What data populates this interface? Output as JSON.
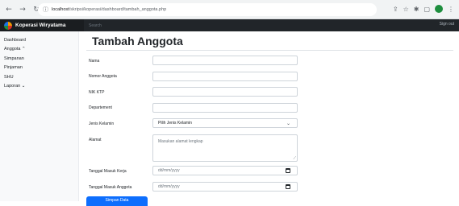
{
  "browser": {
    "url_host": "localhost",
    "url_path": "/skripsi/koperasi/dashboard/tambah_anggota.php",
    "back_icon": "arrow-left-icon",
    "forward_icon": "arrow-right-icon",
    "reload_icon": "reload-icon"
  },
  "navbar": {
    "brand": "Koperasi Wiryatama",
    "search_placeholder": "Search",
    "signout": "Sign out"
  },
  "sidebar": {
    "items": [
      {
        "label": "Dashboard"
      },
      {
        "label": "Anggota ⌃"
      },
      {
        "label": "Simpanan"
      },
      {
        "label": "Pinjaman"
      },
      {
        "label": "SHU"
      },
      {
        "label": "Laporan ⌄"
      }
    ]
  },
  "main": {
    "title": "Tambah Anggota",
    "fields": {
      "nama": {
        "label": "Nama",
        "value": ""
      },
      "nomor": {
        "label": "Nomor Anggota",
        "value": ""
      },
      "nik": {
        "label": "NIK KTP",
        "value": ""
      },
      "departemen": {
        "label": "Departement",
        "value": ""
      },
      "jenis_kelamin": {
        "label": "Jenis Kelamin",
        "value": "Pilih Jenis Kelamin"
      },
      "alamat": {
        "label": "Alamat",
        "placeholder": "Masukan alamat lengkap"
      },
      "tgl_kerja": {
        "label": "Tanggal Masuk Kerja",
        "value": "dd/mm/yyyy"
      },
      "tgl_anggota": {
        "label": "Tanggal Masuk Anggota",
        "value": "dd/mm/yyyy"
      }
    },
    "submit_label": "Simpan Data"
  },
  "colors": {
    "navbar": "#212529",
    "sidebar": "#f8f9fa",
    "primary": "#0d6efd"
  }
}
